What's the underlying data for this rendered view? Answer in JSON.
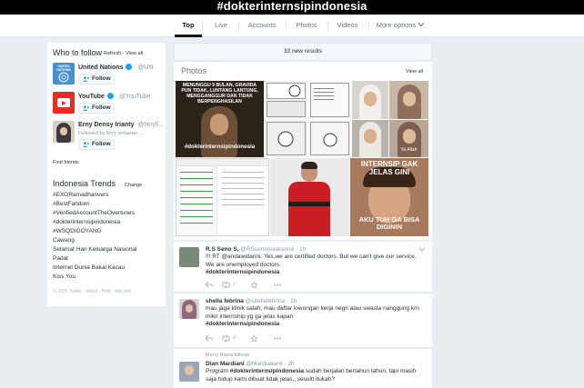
{
  "banner": {
    "title": "#dokterinternsipindonesia"
  },
  "nav": {
    "tabs": [
      "Top",
      "Live",
      "Accounts",
      "Photos",
      "Videos",
      "More options"
    ]
  },
  "who_to_follow": {
    "title": "Who to follow",
    "refresh": "Refresh",
    "sep": "·",
    "view_all": "View all",
    "follow_label": "Follow",
    "accounts": [
      {
        "name": "United Nations",
        "handle": "@UN",
        "avatar_text": "UNITED NATIONS",
        "avatar_color": "#4a90c8"
      },
      {
        "name": "YouTube",
        "handle": "@YouTube",
        "avatar_color": "#e52d27"
      },
      {
        "name": "Erny Densy Irianty",
        "handle": "@Nnyll...",
        "followed_by": "Followed by ferry setiawan ..."
      }
    ],
    "find_friends": "Find friends"
  },
  "trends": {
    "title": "Indonesia Trends",
    "sep": "·",
    "change": "Change",
    "items": [
      "#EXORamadhanvers",
      "#BestFandom",
      "#VerifiedAccountTheOvertunes",
      "#dokterinternsipindonesia",
      "#WSQDIGOYANG",
      "Cawang",
      "Selamat Hari Keluarga Nasional",
      "Padat",
      "Internet Dunia Bakal Kacau",
      "Kiss You"
    ]
  },
  "footer": "© 2015 Twitter · About · Help · Ads info",
  "results": {
    "new_results": "33 new results"
  },
  "photos": {
    "title": "Photos",
    "view_all": "View all",
    "meme1_top": "MENUNGGU 9 BULAN, GRAVIDA PUN TIDAK, LUNTANG LANTUNG, MENGGANGGUR DAN TIDAK BERPENGHASILAN",
    "meme1_bottom": "#dokterinternsipindonesia",
    "meme2_top": "INTERNSIP GAK JELAS GINI",
    "meme2_bottom": "AKU TUH GA BISA DIGININ",
    "meme3_caption": "Ya Allah"
  },
  "tweets": [
    {
      "name": "R.S Seno S,",
      "handle": "@RSsenosulaksono",
      "time": "1h",
      "text": "!!! RT @andawidarini: Yes,we are certified doctors. But we can't give our service. We are unemployed doctors.",
      "hashtag": "#dokterinternsipindonesia",
      "retweets": "2",
      "avatar_color": "#7a8a78"
    },
    {
      "name": "shella febrina",
      "handle": "@shellafebrina",
      "time": "1h",
      "text": "mau jaga klinik salah, mau daftar lowongan kerja negri atau swasta nanggung krn mikir internship yg ga jelas kapan",
      "hashtag": "#dokterinternsipindonesia",
      "retweets": "4",
      "avatar_color": "#8e6a7c"
    },
    {
      "retweeted_by": "Merry Riana follows",
      "name": "Dian Mardiani",
      "handle": "@Mardiaaanii",
      "time": "2h",
      "text_prefix": "Program",
      "hashtag": "#dokterinternsipindonesia",
      "text": "sudah berjalan bertahun tahun, tapi masih saja hidup kami dibuat tidak jelas,, sesulit itukah?",
      "avatar_color": "#9aa7b4"
    }
  ],
  "colors": {
    "link": "#1da1f2",
    "gray_bg": "#e9eef2"
  }
}
